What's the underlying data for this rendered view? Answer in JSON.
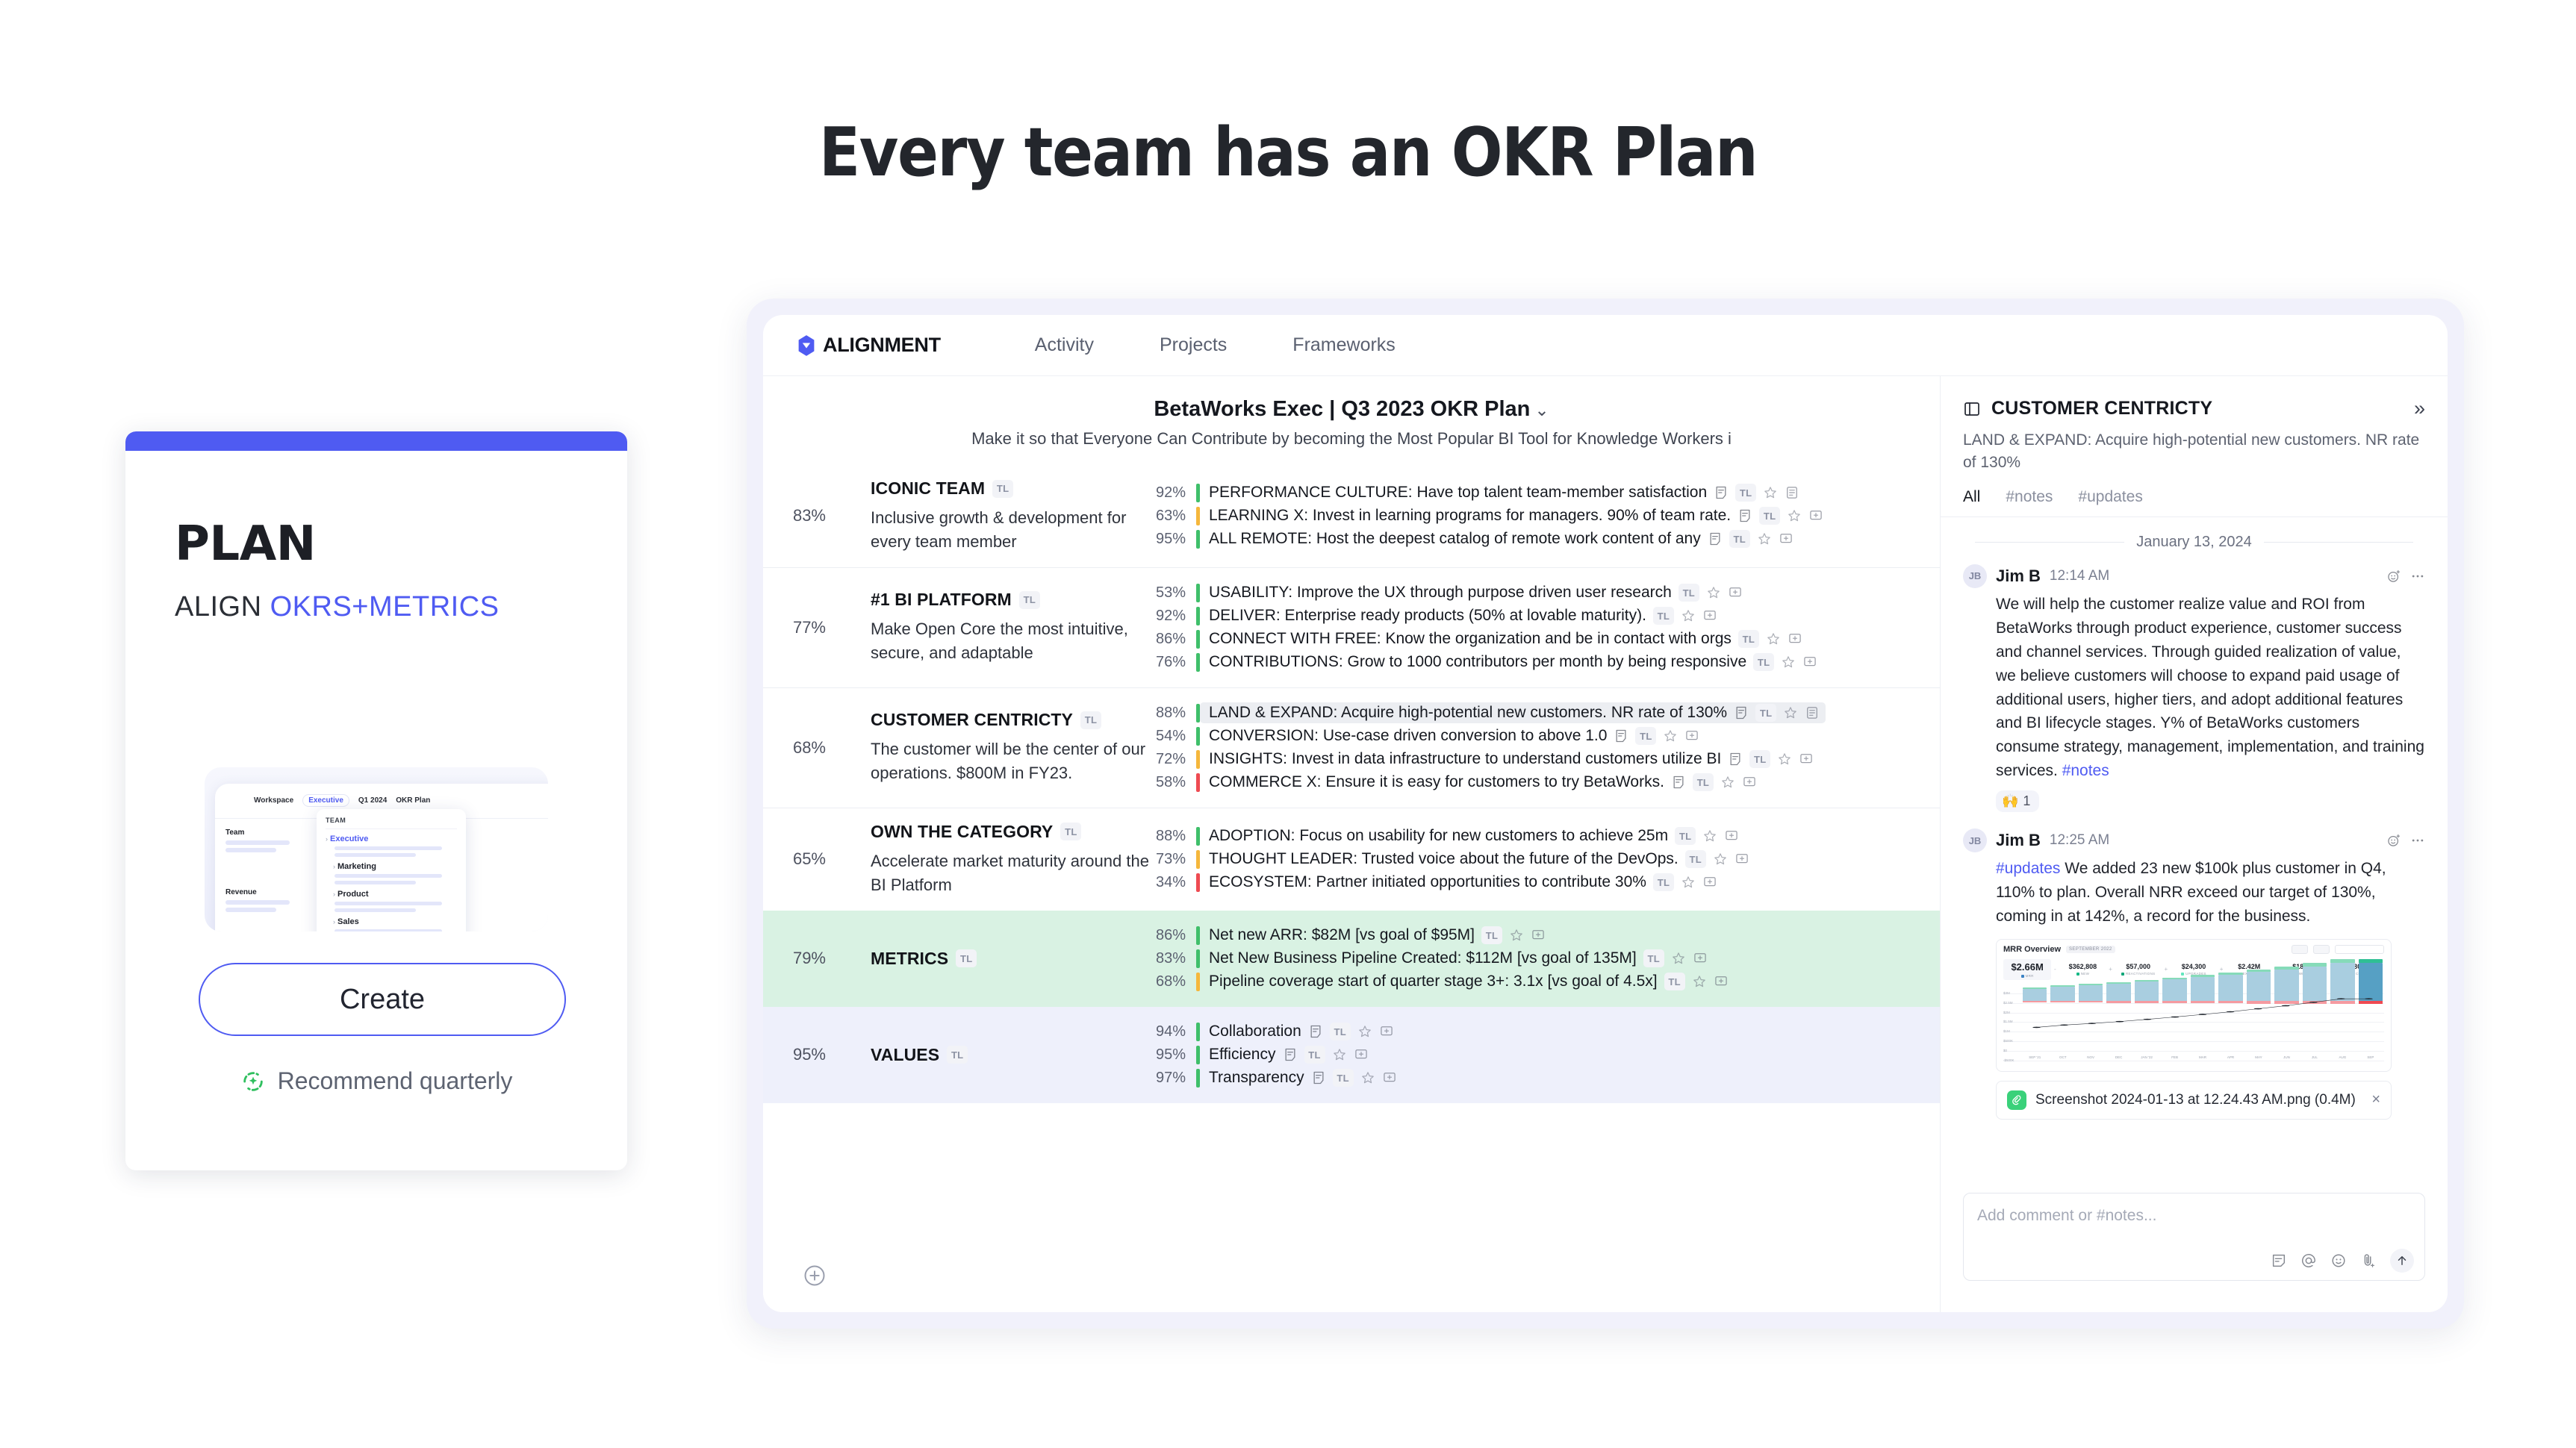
{
  "headline": "Every team has an OKR Plan",
  "plan_card": {
    "title": "PLAN",
    "subtitle_prefix": "ALIGN ",
    "subtitle_accent": "OKRS+METRICS",
    "create_label": "Create",
    "recommend_label": "Recommend quarterly",
    "thumbnail": {
      "breadcrumb": [
        "Workspace",
        "Executive",
        "Q1 2024",
        "OKR Plan"
      ],
      "active_crumb": "Executive",
      "panel_header": "TEAM",
      "rows": [
        "Executive",
        "Marketing",
        "Product",
        "Sales"
      ],
      "left_labels": [
        "Team",
        "Revenue"
      ]
    }
  },
  "app": {
    "brand": "ALIGNMENT",
    "nav": [
      "Activity",
      "Projects",
      "Frameworks"
    ],
    "plan_title": "BetaWorks Exec | Q3 2023 OKR Plan",
    "plan_title_chevron": "⌄",
    "plan_subtitle": "Make it so that Everyone Can Contribute by becoming the Most Popular BI Tool for Knowledge Workers i",
    "okrs": [
      {
        "pct": "83%",
        "name": "ICONIC TEAM",
        "chip": "TL",
        "desc": "Inclusive growth & development for every team member",
        "krs": [
          {
            "pct": "92%",
            "color": "#3fbf6a",
            "text": "PERFORMANCE CULTURE: Have top talent team-member satisfaction",
            "note": true,
            "doc": true,
            "highlight": false
          },
          {
            "pct": "63%",
            "color": "#f5b73c",
            "text": "LEARNING X: Invest in learning programs for managers. 90% of team rate.",
            "note": true,
            "doc": false,
            "highlight": false
          },
          {
            "pct": "95%",
            "color": "#3fbf6a",
            "text": "ALL REMOTE: Host the deepest catalog of remote work content of any",
            "note": true,
            "doc": false,
            "highlight": false
          }
        ]
      },
      {
        "pct": "77%",
        "name": "#1 BI PLATFORM",
        "chip": "TL",
        "desc": "Make Open Core the most intuitive, secure, and adaptable",
        "krs": [
          {
            "pct": "53%",
            "color": "#3fbf6a",
            "text": "USABILITY: Improve the UX through purpose driven user research",
            "note": false,
            "doc": false,
            "highlight": false
          },
          {
            "pct": "92%",
            "color": "#3fbf6a",
            "text": "DELIVER: Enterprise ready products (50% at lovable maturity).",
            "note": false,
            "doc": false,
            "highlight": false
          },
          {
            "pct": "86%",
            "color": "#3fbf6a",
            "text": "CONNECT WITH FREE: Know the organization and be in contact with orgs",
            "note": false,
            "doc": false,
            "highlight": false
          },
          {
            "pct": "76%",
            "color": "#3fbf6a",
            "text": "CONTRIBUTIONS: Grow to 1000 contributors per month by being responsive",
            "note": false,
            "doc": false,
            "highlight": false
          }
        ]
      },
      {
        "pct": "68%",
        "name": "CUSTOMER CENTRICTY",
        "chip": "TL",
        "desc": "The customer will be the center of our operations. $800M in FY23.",
        "krs": [
          {
            "pct": "88%",
            "color": "#3fbf6a",
            "text": "LAND & EXPAND: Acquire high-potential new customers. NR rate of 130%",
            "note": true,
            "doc": true,
            "highlight": true
          },
          {
            "pct": "54%",
            "color": "#3fbf6a",
            "text": "CONVERSION: Use-case driven conversion to above 1.0",
            "note": true,
            "doc": false,
            "highlight": false
          },
          {
            "pct": "72%",
            "color": "#f5b73c",
            "text": "INSIGHTS: Invest in data infrastructure to understand customers utilize BI",
            "note": true,
            "doc": false,
            "highlight": false
          },
          {
            "pct": "58%",
            "color": "#ee4b52",
            "text": "COMMERCE X: Ensure it is easy for customers to try BetaWorks.",
            "note": true,
            "doc": false,
            "highlight": false
          }
        ]
      },
      {
        "pct": "65%",
        "name": "OWN THE CATEGORY",
        "chip": "TL",
        "desc": "Accelerate market maturity around the BI Platform",
        "krs": [
          {
            "pct": "88%",
            "color": "#3fbf6a",
            "text": "ADOPTION: Focus on usability for new customers to achieve 25m",
            "note": false,
            "doc": false,
            "highlight": false
          },
          {
            "pct": "73%",
            "color": "#f5b73c",
            "text": "THOUGHT LEADER: Trusted voice about the future of the DevOps.",
            "note": false,
            "doc": false,
            "highlight": false
          },
          {
            "pct": "34%",
            "color": "#ee4b52",
            "text": "ECOSYSTEM: Partner initiated opportunities to contribute 30%",
            "note": false,
            "doc": false,
            "highlight": false
          }
        ]
      }
    ],
    "metrics": {
      "pct": "79%",
      "name": "METRICS",
      "chip": "TL",
      "krs": [
        {
          "pct": "86%",
          "color": "#3fbf6a",
          "text": "Net new ARR: $82M [vs goal of $95M]",
          "note": false,
          "doc": false,
          "highlight": false
        },
        {
          "pct": "83%",
          "color": "#3fbf6a",
          "text": "Net New Business Pipeline Created: $112M [vs goal of 135M]",
          "note": false,
          "doc": false,
          "highlight": false
        },
        {
          "pct": "68%",
          "color": "#f5b73c",
          "text": "Pipeline coverage start of quarter stage 3+: 3.1x [vs goal of 4.5x]",
          "note": false,
          "doc": false,
          "highlight": false
        }
      ]
    },
    "values": {
      "pct": "95%",
      "name": "VALUES",
      "chip": "TL",
      "krs": [
        {
          "pct": "94%",
          "color": "#3fbf6a",
          "text": "Collaboration",
          "note": true,
          "doc": false,
          "highlight": false
        },
        {
          "pct": "95%",
          "color": "#3fbf6a",
          "text": "Efficiency",
          "note": true,
          "doc": false,
          "highlight": false
        },
        {
          "pct": "97%",
          "color": "#3fbf6a",
          "text": "Transparency",
          "note": true,
          "doc": false,
          "highlight": false
        }
      ]
    }
  },
  "sidebar": {
    "title": "CUSTOMER CENTRICTY",
    "subtitle": "LAND & EXPAND: Acquire high-potential new customers. NR rate of 130%",
    "expand_glyph": "»",
    "tabs": [
      "All",
      "#notes",
      "#updates"
    ],
    "active_tab": "All",
    "date_separator": "January 13, 2024",
    "comments": [
      {
        "avatar": "JB",
        "author": "Jim B",
        "time": "12:14 AM",
        "body": "We will help the customer realize value and ROI from BetaWorks through product experience, customer success and channel services. Through guided realization of value, we believe customers will choose to expand paid usage of additional users, higher tiers, and adopt additional features and BI lifecycle stages. Y% of BetaWorks customers consume strategy, management, implementation, and training services. ",
        "tag": "#notes",
        "tag_position": "end",
        "reaction_emoji": "🙌",
        "reaction_count": "1"
      },
      {
        "avatar": "JB",
        "author": "Jim B",
        "time": "12:25 AM",
        "tag": "#updates",
        "tag_position": "start",
        "body": "  We added 23 new $100k plus customer in Q4, 110% to plan.  Overall NRR exceed our target of 130%, coming in at 142%, a record for the business."
      }
    ],
    "attachment": {
      "filename": "Screenshot 2024-01-13 at 12.24.43 AM.png (0.4M)",
      "close_glyph": "×"
    },
    "composer_placeholder": "Add comment or #notes..."
  },
  "chart_data": {
    "type": "bar",
    "title": "MRR Overview",
    "badge": "SEPTEMBER 2022",
    "range_select": "PAST YEAR",
    "kpis": [
      {
        "value": "$2.66M",
        "label": "MRR",
        "color": "#3b82c4",
        "op": ""
      },
      {
        "value": "$362,808",
        "label": "NEW",
        "color": "#12b886",
        "op": "-"
      },
      {
        "value": "$57,000",
        "label": "REACTIVATIONS",
        "color": "#0ca678",
        "op": "+"
      },
      {
        "value": "$24,300",
        "label": "UPGRADES",
        "color": "#63e6be",
        "op": "+"
      },
      {
        "value": "$2.42M",
        "label": "EXISTING",
        "color": "#4dabf7",
        "op": "+"
      },
      {
        "value": "$18,858",
        "label": "DOWNGRADES",
        "color": "#ff922b",
        "op": "-"
      },
      {
        "value": "$180,100",
        "label": "CHURN",
        "color": "#fa5252",
        "op": "-"
      }
    ],
    "categories": [
      "SEP '21",
      "OCT",
      "NOV",
      "DEC",
      "JAN '22",
      "FEB",
      "MAR",
      "APR",
      "MAY",
      "JUN",
      "JUL",
      "AUG",
      "SEP"
    ],
    "series": [
      {
        "name": "Existing",
        "color": "#a9cee0",
        "values": [
          0.8,
          0.93,
          1.02,
          1.12,
          1.24,
          1.38,
          1.52,
          1.68,
          1.85,
          2.02,
          2.22,
          2.42,
          2.42
        ]
      },
      {
        "name": "New",
        "color": "#86dbb9",
        "values": [
          0.05,
          0.07,
          0.08,
          0.1,
          0.12,
          0.13,
          0.15,
          0.16,
          0.18,
          0.2,
          0.22,
          0.24,
          0.24
        ]
      },
      {
        "name": "Churn",
        "color": "#f59aa0",
        "values": [
          -0.08,
          -0.09,
          -0.09,
          -0.1,
          -0.11,
          -0.12,
          -0.13,
          -0.14,
          -0.15,
          -0.16,
          -0.17,
          -0.18,
          -0.18
        ]
      }
    ],
    "line": {
      "name": "MRR",
      "values": [
        0.85,
        1.0,
        1.1,
        1.22,
        1.36,
        1.51,
        1.67,
        1.84,
        2.03,
        2.22,
        2.44,
        2.66,
        2.66
      ]
    },
    "ylabels": [
      "$3M",
      "$2.5M",
      "$2M",
      "$1.5M",
      "$1M",
      "$500K",
      "$0",
      "-$500K"
    ],
    "ylim": [
      -0.5,
      3.0
    ],
    "grid": true,
    "legend": "top"
  }
}
